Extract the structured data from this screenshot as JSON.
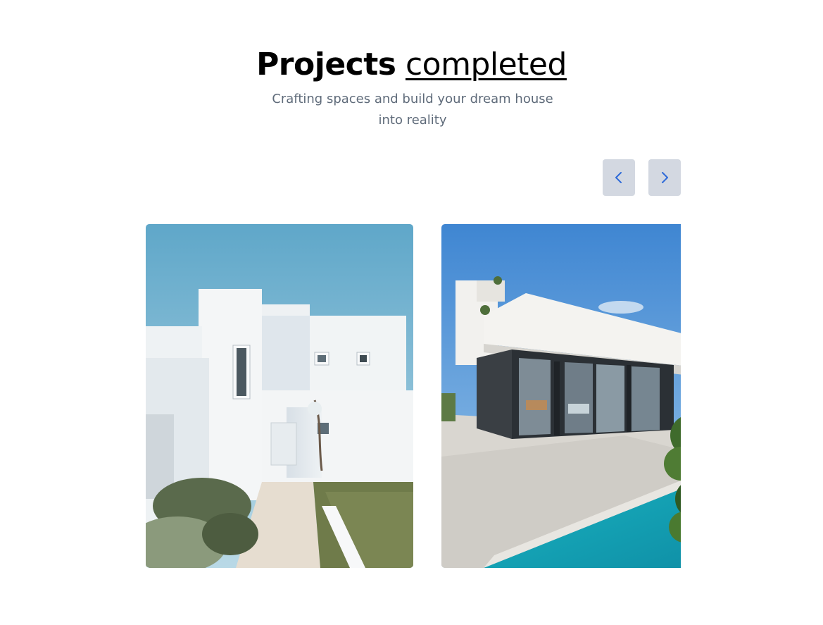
{
  "header": {
    "title_strong": "Projects",
    "title_accent": "completed",
    "subtitle": "Crafting spaces and build your dream house into reality"
  },
  "carousel": {
    "prev_icon": "chevron-left-icon",
    "next_icon": "chevron-right-icon",
    "slides": [
      {
        "name": "white-house-photo"
      },
      {
        "name": "pool-villa-photo"
      }
    ]
  },
  "colors": {
    "nav_button_bg": "#d3d8e1",
    "nav_icon": "#2f6bd8",
    "subtitle": "#5f6b7a"
  }
}
